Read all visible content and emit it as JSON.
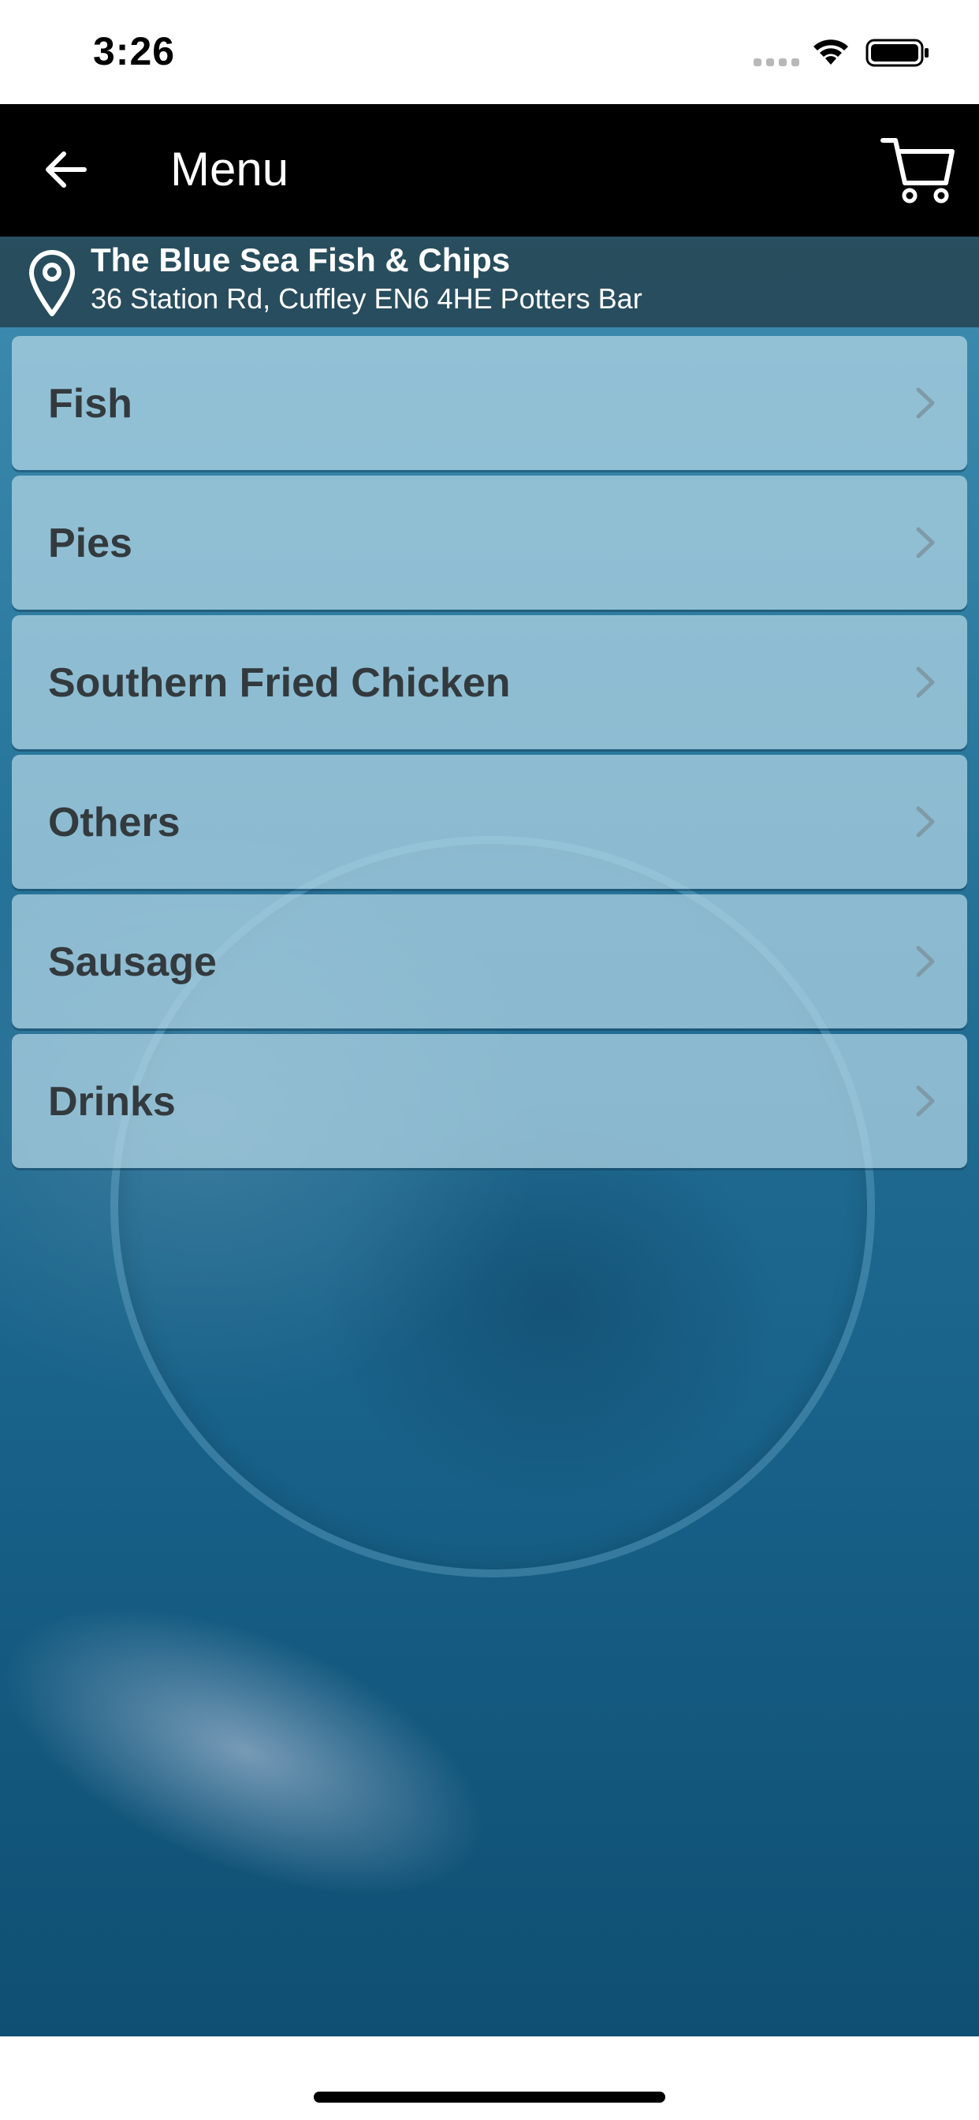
{
  "status_bar": {
    "time": "3:26",
    "icons": [
      "signal-icon",
      "wifi-icon",
      "battery-icon"
    ]
  },
  "header": {
    "title": "Menu",
    "back_icon": "arrow-left-icon",
    "cart_icon": "shopping-cart-icon",
    "background_color": "#000000"
  },
  "restaurant": {
    "icon": "location-pin-icon",
    "name": "The Blue Sea Fish & Chips",
    "address": "36 Station Rd, Cuffley EN6 4HE Potters Bar"
  },
  "menu": {
    "categories": [
      {
        "label": "Fish"
      },
      {
        "label": "Pies"
      },
      {
        "label": "Southern Fried Chicken"
      },
      {
        "label": "Others"
      },
      {
        "label": "Sausage"
      },
      {
        "label": "Drinks"
      }
    ],
    "item_icon": "chevron-right-icon"
  },
  "colors": {
    "accent_bg": "#236f96",
    "item_bg": "#b4d7e6",
    "item_text": "#333a3e",
    "info_bar_bg": "#233c48"
  }
}
